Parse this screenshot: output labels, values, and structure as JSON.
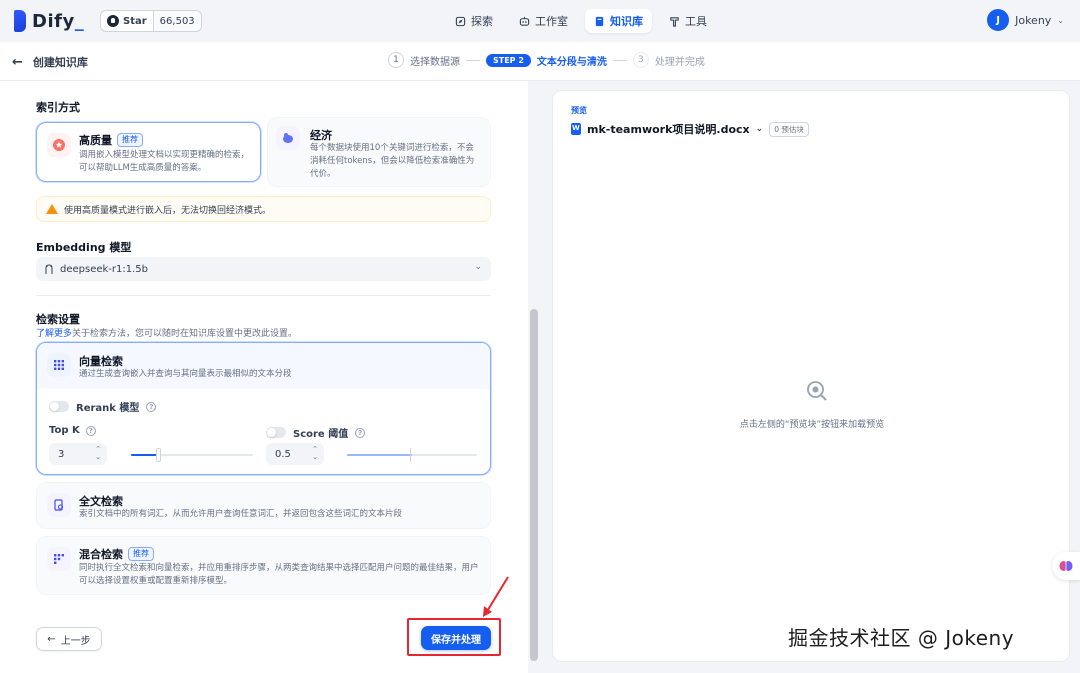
{
  "app": {
    "name": "Dify",
    "star_label": "Star",
    "star_count": "66,503"
  },
  "nav": {
    "items": [
      {
        "label": "探索",
        "icon": "compass-icon"
      },
      {
        "label": "工作室",
        "icon": "robot-icon"
      },
      {
        "label": "知识库",
        "icon": "book-icon"
      },
      {
        "label": "工具",
        "icon": "hammer-icon"
      }
    ]
  },
  "user": {
    "initial": "J",
    "name": "Jokeny"
  },
  "header": {
    "back_title": "创建知识库",
    "steps": [
      {
        "num": "1",
        "label": "选择数据源"
      },
      {
        "num": "STEP 2",
        "label": "文本分段与清洗"
      },
      {
        "num": "3",
        "label": "处理并完成"
      }
    ]
  },
  "index_mode": {
    "title": "索引方式",
    "high_quality": {
      "title": "高质量",
      "tag": "推荐",
      "desc": "调用嵌入模型处理文档以实现更精确的检索，可以帮助LLM生成高质量的答案。"
    },
    "economy": {
      "title": "经济",
      "desc": "每个数据块使用10个关键词进行检索，不会消耗任何tokens，但会以降低检索准确性为代价。"
    },
    "warning": "使用高质量模式进行嵌入后，无法切换回经济模式。"
  },
  "embedding": {
    "title": "Embedding 模型",
    "model": "deepseek-r1:1.5b"
  },
  "retrieval": {
    "title": "检索设置",
    "hint_link": "了解更多",
    "hint_rest": "关于检索方法，您可以随时在知识库设置中更改此设置。",
    "vector": {
      "title": "向量检索",
      "desc": "通过生成查询嵌入并查询与其向量表示最相似的文本分段",
      "rerank_label": "Rerank 模型",
      "topk_label": "Top K",
      "topk_value": "3",
      "score_label": "Score 阈值",
      "score_value": "0.5"
    },
    "fulltext": {
      "title": "全文检索",
      "desc": "索引文档中的所有词汇，从而允许用户查询任意词汇，并返回包含这些词汇的文本片段"
    },
    "hybrid": {
      "title": "混合检索",
      "tag": "推荐",
      "desc": "同时执行全文检索和向量检索，并应用重排序步骤，从两类查询结果中选择匹配用户问题的最佳结果，用户可以选择设置权重或配置重新排序模型。"
    }
  },
  "footer": {
    "prev_label": "上一步",
    "save_label": "保存并处理"
  },
  "preview": {
    "label": "预览",
    "file_name": "mk-teamwork项目说明.docx",
    "chunk_count": "0 预估块",
    "empty_text": "点击左侧的“预览块”按钮来加载预览"
  },
  "watermark": "掘金技术社区 @ Jokeny",
  "colors": {
    "primary": "#155eef",
    "warning": "#f79009",
    "highlight_frame": "#e5282e"
  }
}
